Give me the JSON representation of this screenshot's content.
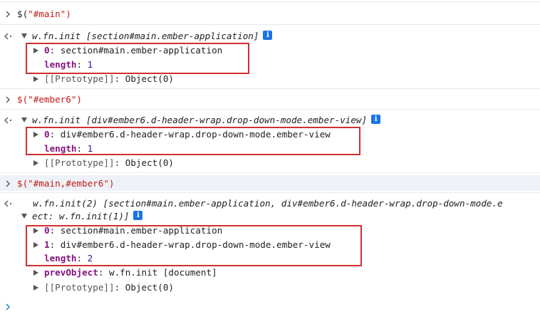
{
  "console": {
    "cmd1": "$(\"#main\")",
    "res1": {
      "summary_fn": "w.fn.init",
      "summary_rest": " [section#main.ember-application]",
      "row0_key": "0",
      "row0_val": "section#main.ember-application",
      "length_key": "length",
      "length_val": "1",
      "proto_label": "[[Prototype]]",
      "proto_val": "Object(0)"
    },
    "cmd2": "$(\"#ember6\")",
    "res2": {
      "summary_fn": "w.fn.init",
      "summary_rest": " [div#ember6.d-header-wrap.drop-down-mode.ember-view]",
      "row0_key": "0",
      "row0_val": "div#ember6.d-header-wrap.drop-down-mode.ember-view",
      "length_key": "length",
      "length_val": "1",
      "proto_label": "[[Prototype]]",
      "proto_val": "Object(0)"
    },
    "cmd3": "$(\"#main,#ember6\")",
    "res3": {
      "summary_fn": "w.fn.init(2)",
      "summary_rest": " [section#main.ember-application, div#ember6.d-header-wrap.drop-down-mode.e",
      "summary_cont": "ect: w.fn.init(1)]",
      "row0_key": "0",
      "row0_val": "section#main.ember-application",
      "row1_key": "1",
      "row1_val": "div#ember6.d-header-wrap.drop-down-mode.ember-view",
      "length_key": "length",
      "length_val": "2",
      "prev_key": "prevObject",
      "prev_fn": "w.fn.init",
      "prev_rest": " [document]",
      "proto_label": "[[Prototype]]",
      "proto_val": "Object(0)"
    },
    "colon": ": ",
    "info_glyph": "i"
  },
  "colors": {
    "key": "#881280",
    "string": "#c41a16",
    "highlight_box": "#d32f2f",
    "info_badge": "#1a73e8",
    "prompt": "#1a73e8"
  }
}
